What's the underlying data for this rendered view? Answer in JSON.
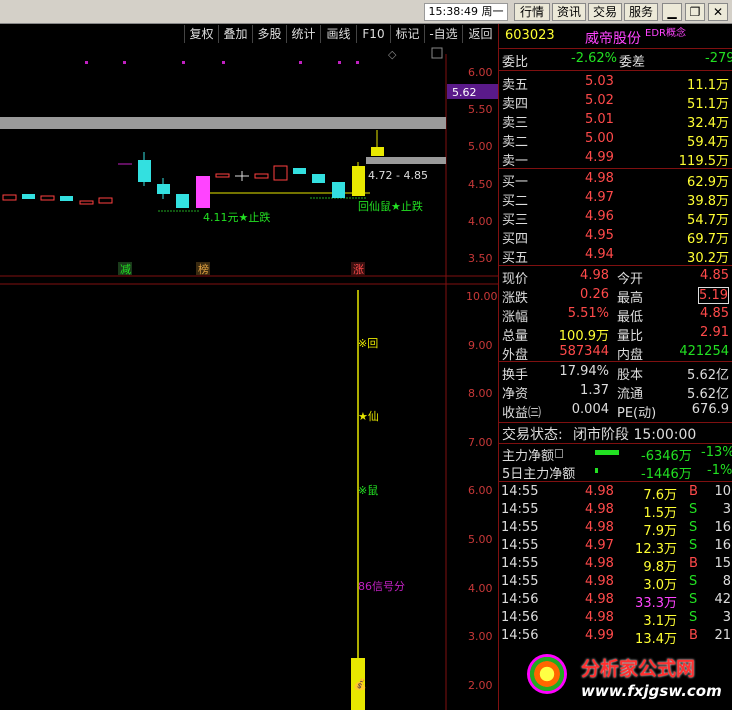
{
  "window": {
    "clock": "15:38:49 周一",
    "buttons": [
      "行情",
      "资讯",
      "交易",
      "服务"
    ]
  },
  "toolbar": [
    "复权",
    "叠加",
    "多股",
    "统计",
    "画线",
    "F10",
    "标记",
    "-自选",
    "返回"
  ],
  "main_chart": {
    "axis": [
      "6.00",
      "5.50",
      "5.00",
      "4.50",
      "4.00",
      "3.50"
    ],
    "price_tag": "5.62",
    "range_text": "4.72 - 4.85",
    "stop_label": "4.11元★止跌",
    "stop_label2": "回仙鼠★止跌",
    "markers": [
      "减",
      "榜",
      "涨"
    ],
    "price_tag_color": "#5a1a8a"
  },
  "indicator": {
    "axis": [
      "10.00",
      "9.00",
      "8.00",
      "7.00",
      "6.00",
      "5.00",
      "4.00",
      "3.00",
      "2.00"
    ],
    "labels": [
      "※回",
      "★仙",
      "※鼠",
      "86信号分"
    ]
  },
  "quote": {
    "code": "603023",
    "name": "威帝股份",
    "tag": "EDR概念",
    "weibi_label": "委比",
    "weibi": "-2.62%",
    "weicha_label": "委差",
    "weicha": "-279",
    "sell": [
      {
        "label": "卖五",
        "price": "5.03",
        "vol": "11.1万"
      },
      {
        "label": "卖四",
        "price": "5.02",
        "vol": "51.1万"
      },
      {
        "label": "卖三",
        "price": "5.01",
        "vol": "32.4万"
      },
      {
        "label": "卖二",
        "price": "5.00",
        "vol": "59.4万"
      },
      {
        "label": "卖一",
        "price": "4.99",
        "vol": "119.5万"
      }
    ],
    "buy": [
      {
        "label": "买一",
        "price": "4.98",
        "vol": "62.9万"
      },
      {
        "label": "买二",
        "price": "4.97",
        "vol": "39.8万"
      },
      {
        "label": "买三",
        "price": "4.96",
        "vol": "54.7万"
      },
      {
        "label": "买四",
        "price": "4.95",
        "vol": "69.7万"
      },
      {
        "label": "买五",
        "price": "4.94",
        "vol": "30.2万"
      }
    ],
    "stats_left": [
      {
        "label": "现价",
        "value": "4.98"
      },
      {
        "label": "涨跌",
        "value": "0.26"
      },
      {
        "label": "涨幅",
        "value": "5.51%"
      },
      {
        "label": "总量",
        "value": "100.9万"
      },
      {
        "label": "外盘",
        "value": "587344"
      }
    ],
    "stats_right": [
      {
        "label": "今开",
        "value": "4.85"
      },
      {
        "label": "最高",
        "value": "5.19"
      },
      {
        "label": "最低",
        "value": "4.85"
      },
      {
        "label": "量比",
        "value": "2.91"
      },
      {
        "label": "内盘",
        "value": "421254"
      }
    ],
    "cap_left": [
      {
        "label": "换手",
        "value": "17.94%"
      },
      {
        "label": "净资",
        "value": "1.37"
      },
      {
        "label": "收益㈢",
        "value": "0.004"
      }
    ],
    "cap_right": [
      {
        "label": "股本",
        "value": "5.62亿"
      },
      {
        "label": "流通",
        "value": "5.62亿"
      },
      {
        "label": "PE(动)",
        "value": "676.9"
      }
    ],
    "status_label": "交易状态:",
    "status_value": "闭市阶段 15:00:00",
    "flow1_label": "主力净额",
    "flow1_value": "-6346万",
    "flow1_pct": "-13%",
    "flow2_label": "5日主力净额",
    "flow2_value": "-1446万",
    "flow2_pct": "-1%"
  },
  "ticks": [
    {
      "time": "14:55",
      "price": "4.98",
      "vol": "7.6万",
      "bs": "B",
      "n": "10"
    },
    {
      "time": "14:55",
      "price": "4.98",
      "vol": "1.5万",
      "bs": "S",
      "n": "3"
    },
    {
      "time": "14:55",
      "price": "4.98",
      "vol": "7.9万",
      "bs": "S",
      "n": "16"
    },
    {
      "time": "14:55",
      "price": "4.97",
      "vol": "12.3万",
      "bs": "S",
      "n": "16"
    },
    {
      "time": "14:55",
      "price": "4.98",
      "vol": "9.8万",
      "bs": "B",
      "n": "15"
    },
    {
      "time": "14:55",
      "price": "4.98",
      "vol": "3.0万",
      "bs": "S",
      "n": "8"
    },
    {
      "time": "14:56",
      "price": "4.98",
      "vol": "33.3万",
      "bs": "S",
      "n": "42"
    },
    {
      "time": "14:56",
      "price": "4.98",
      "vol": "3.1万",
      "bs": "S",
      "n": "3"
    },
    {
      "time": "14:56",
      "price": "4.99",
      "vol": "13.4万",
      "bs": "B",
      "n": "21"
    }
  ],
  "watermark": {
    "title": "分析家公式网",
    "url": "www.fxjgsw.com"
  }
}
